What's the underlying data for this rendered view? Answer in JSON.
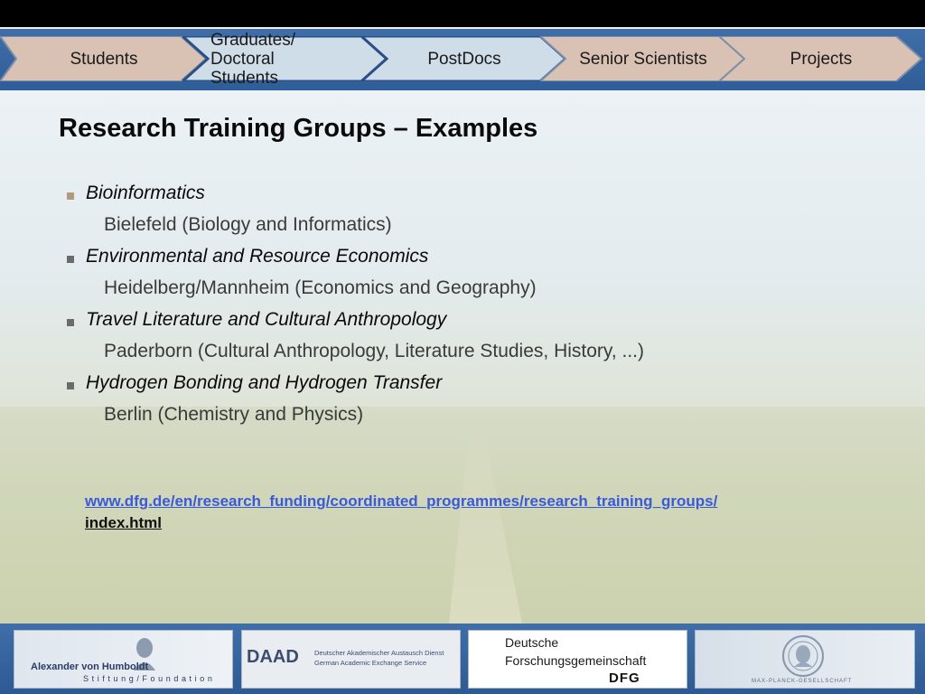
{
  "nav": {
    "tabs": [
      {
        "label": "Students"
      },
      {
        "label": "Graduates/ Doctoral Students"
      },
      {
        "label": "PostDocs"
      },
      {
        "label": "Senior Scientists"
      },
      {
        "label": "Projects"
      }
    ]
  },
  "slide": {
    "title": "Research Training Groups – Examples",
    "topics": [
      {
        "title": "Bioinformatics",
        "detail": "Bielefeld (Biology and Informatics)"
      },
      {
        "title": "Environmental and Resource Economics",
        "detail": "Heidelberg/Mannheim (Economics and Geography)"
      },
      {
        "title": "Travel Literature and Cultural Anthropology",
        "detail": "Paderborn (Cultural Anthropology, Literature Studies, History, ...)"
      },
      {
        "title": "Hydrogen Bonding and Hydrogen Transfer",
        "detail": "Berlin (Chemistry and Physics)"
      }
    ],
    "link_line1": "www.dfg.de/en/research_funding/coordinated_programmes/research_training_groups/",
    "link_line2": "index.html"
  },
  "footer": {
    "humboldt": {
      "name": "Alexander von Humboldt",
      "sub": "Stiftung/Foundation"
    },
    "daad": {
      "name": "DAAD",
      "de": "Deutscher Akademischer Austausch Dienst",
      "en": "German Academic Exchange Service"
    },
    "dfg": {
      "line1": "Deutsche",
      "line2": "Forschungsgemeinschaft",
      "mark": "DFG"
    },
    "mpg": {
      "text": "MAX-PLANCK-GESELLSCHAFT"
    }
  },
  "colors": {
    "nav_band": "#2f5d98",
    "tab_fill": "#d9c2b3",
    "tab_active_fill": "#cfdde9",
    "link": "#3a5ad8"
  }
}
